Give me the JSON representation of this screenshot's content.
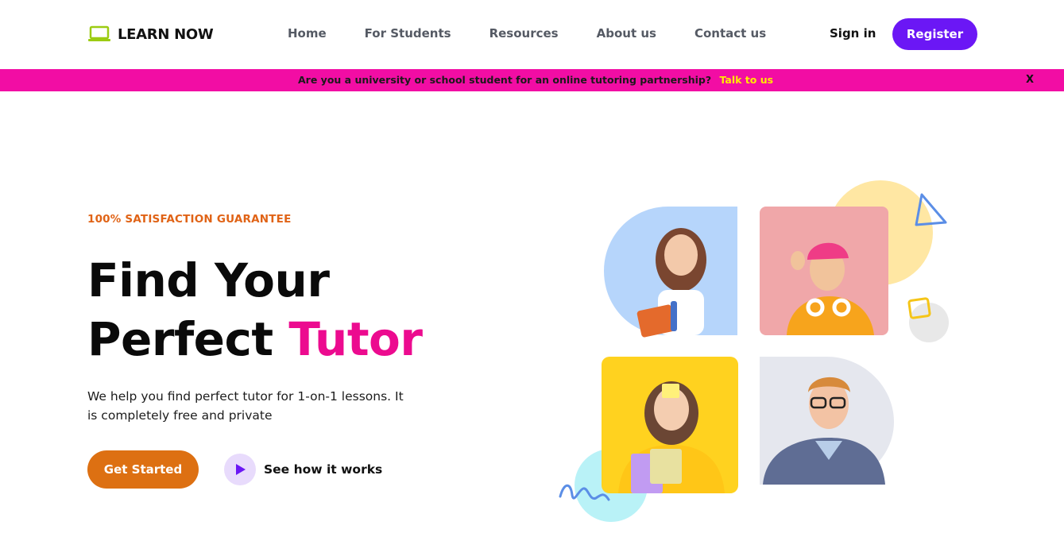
{
  "header": {
    "logo_text": "LEARN NOW",
    "logo_icon": "laptop-icon",
    "nav": [
      {
        "label": "Home"
      },
      {
        "label": "For Students"
      },
      {
        "label": "Resources"
      },
      {
        "label": "About us"
      },
      {
        "label": "Contact us"
      }
    ],
    "signin_label": "Sign in",
    "register_label": "Register"
  },
  "banner": {
    "text": "Are you a university or school student for an online tutoring partnership?",
    "link_label": "Talk to us",
    "close_label": "X"
  },
  "hero": {
    "tagline": "100% SATISFACTION GUARANTEE",
    "headline_line1": "Find Your",
    "headline_line2_plain": "Perfect",
    "headline_line2_accent": "Tutor",
    "subtext": "We help you find perfect tutor for 1-on-1 lessons. It is completely free and private",
    "cta_primary": "Get Started",
    "cta_secondary": "See how it works",
    "cta_secondary_icon": "play-icon"
  },
  "colors": {
    "brand_purple": "#6b17f5",
    "banner_pink": "#f20da4",
    "accent_pink": "#ec0b8f",
    "orange": "#dd7012",
    "link_yellow": "#ffea00",
    "logo_green": "#9ccc12"
  }
}
